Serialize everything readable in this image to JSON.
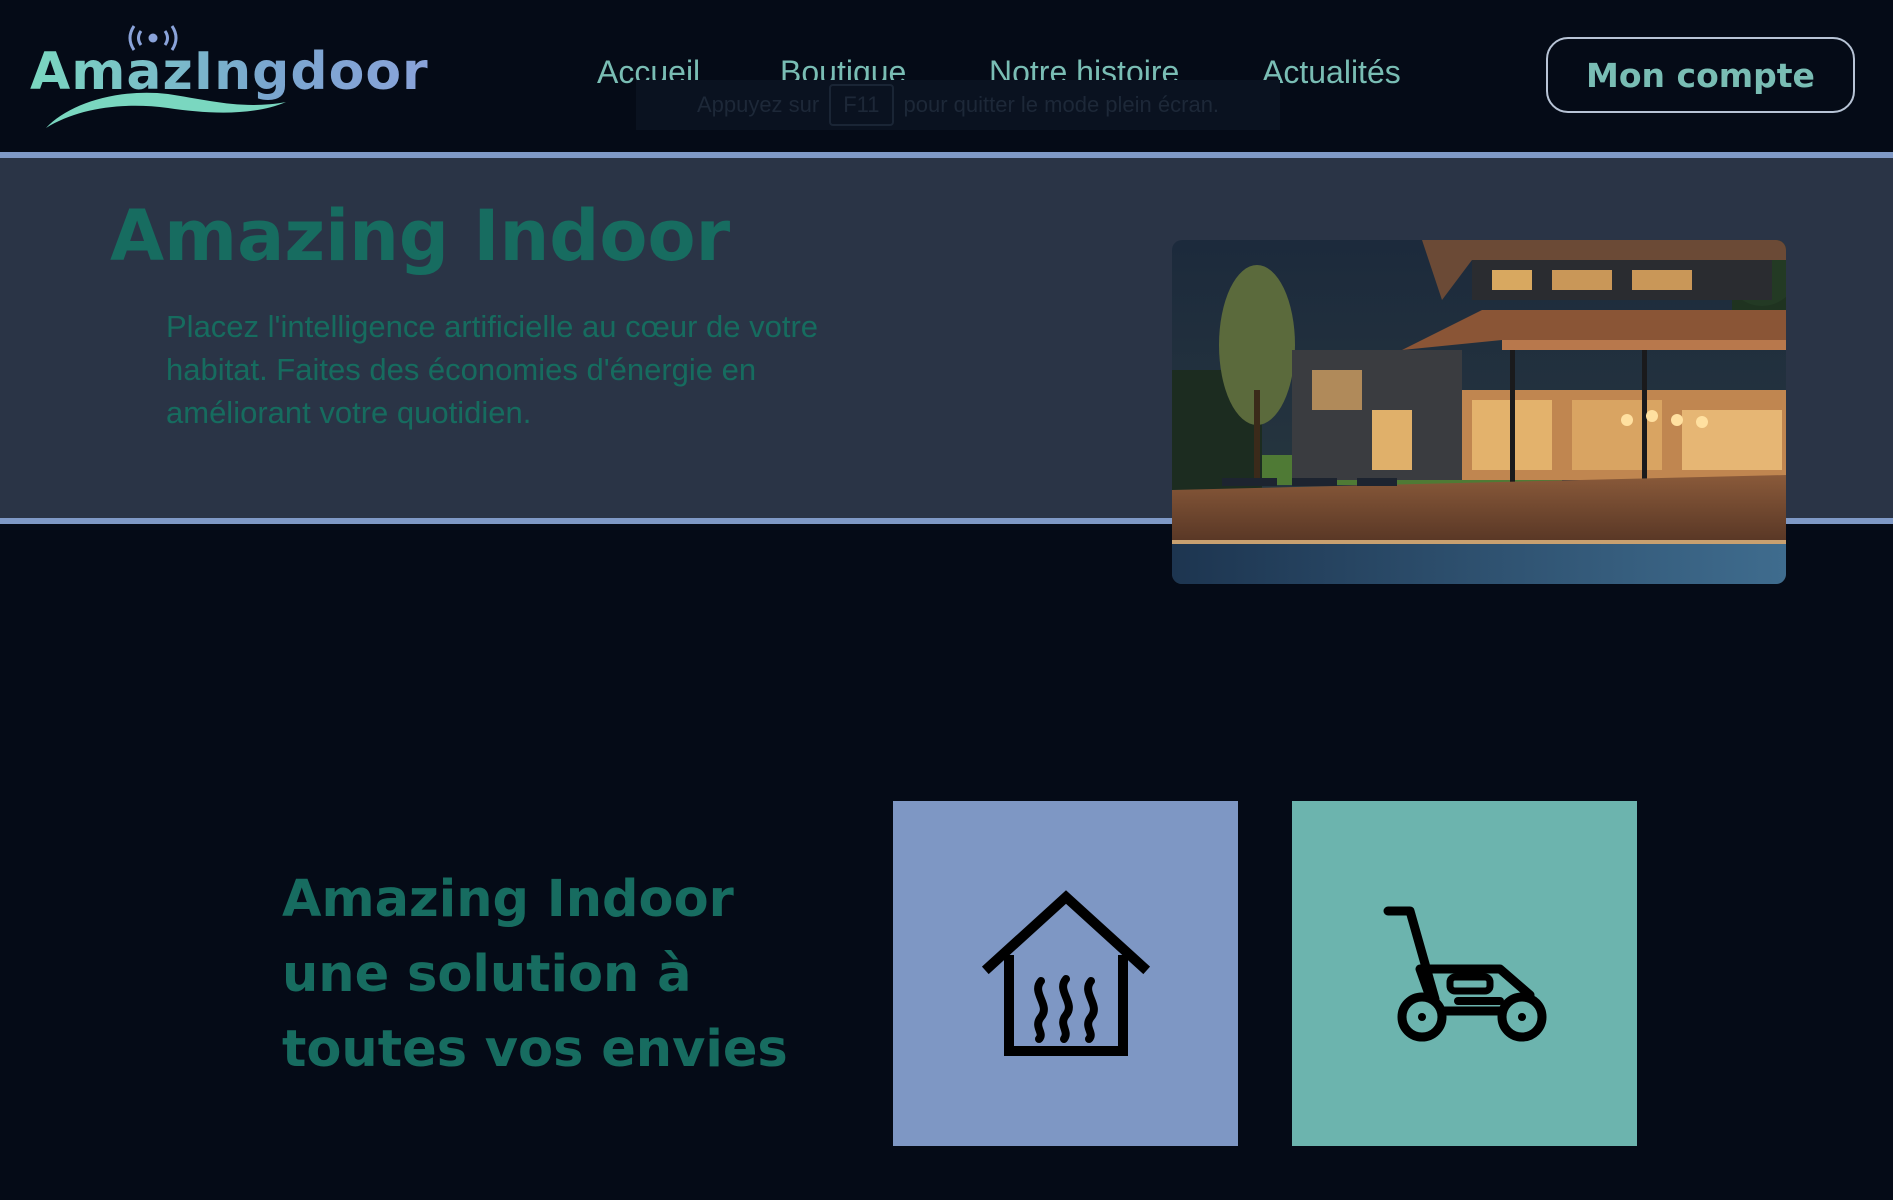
{
  "brand": {
    "logo_text": "AmazIngdoor",
    "logo_icon": "wifi-signal-icon",
    "colors": {
      "teal": "#7ad7c0",
      "blue": "#8aa3da"
    }
  },
  "nav": {
    "items": [
      {
        "label": "Accueil"
      },
      {
        "label": "Boutique"
      },
      {
        "label": "Notre histoire"
      },
      {
        "label": "Actualités"
      }
    ],
    "account_label": "Mon compte"
  },
  "fullscreen_hint": {
    "before": "Appuyez sur",
    "key": "F11",
    "after": "pour quitter le mode plein écran."
  },
  "hero": {
    "title": "Amazing Indoor",
    "text": "Placez l'intelligence artificielle au cœur de votre habitat. Faites des économies d'énergie en améliorant votre quotidien.",
    "image": "modern-house-pool-night-photo"
  },
  "features": {
    "title": "Amazing Indoor une solution à toutes vos envies",
    "cards": [
      {
        "icon": "house-heating-icon",
        "color": "#7e97c4"
      },
      {
        "icon": "lawn-mower-icon",
        "color": "#6cb4ae"
      }
    ]
  },
  "colors": {
    "background": "#050b17",
    "hero_background": "#2a3446",
    "divider": "#7f99c6",
    "accent_text": "#176c60",
    "nav_text": "#79bdb4"
  }
}
